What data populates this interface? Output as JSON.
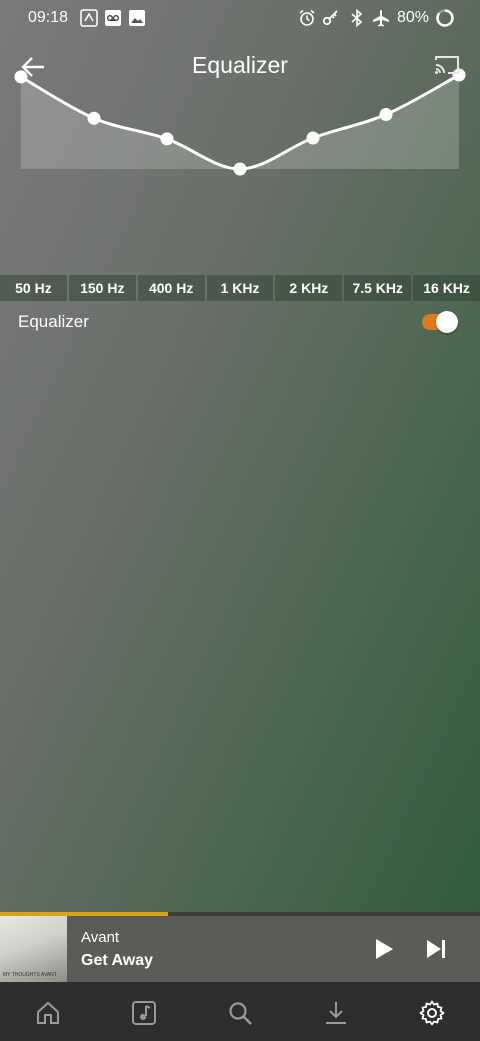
{
  "status_bar": {
    "time": "09:18",
    "battery": "80%"
  },
  "header": {
    "title": "Equalizer"
  },
  "equalizer": {
    "bands": [
      "50 Hz",
      "150 Hz",
      "400 Hz",
      "1 KHz",
      "2 KHz",
      "7.5 KHz",
      "16 KHz"
    ],
    "levels": [
      0.98,
      0.54,
      0.32,
      0.0,
      0.33,
      0.58,
      1.0
    ],
    "toggle_label": "Equalizer",
    "enabled": true,
    "accent_color": "#e07a1f"
  },
  "player": {
    "artist": "Avant",
    "song": "Get Away",
    "album_art_text": "MY THOUGHTS AVANT",
    "progress": 0.35,
    "progress_color": "#d8a21d"
  },
  "nav": {
    "items": [
      "home-icon",
      "music-note-icon",
      "search-icon",
      "download-icon",
      "settings-icon"
    ],
    "active": "settings-icon"
  }
}
